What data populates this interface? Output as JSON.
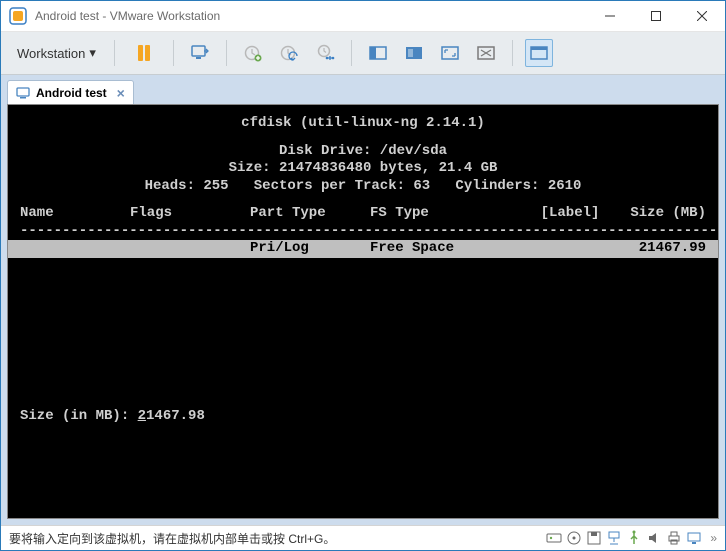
{
  "window": {
    "title": "Android test - VMware Workstation"
  },
  "toolbar": {
    "menu_label": "Workstation"
  },
  "tab": {
    "label": "Android test"
  },
  "terminal": {
    "program": "cfdisk (util-linux-ng 2.14.1)",
    "drive_label": "Disk Drive: /dev/sda",
    "size_line": "Size: 21474836480 bytes, 21.4 GB",
    "geom_line": "Heads: 255   Sectors per Track: 63   Cylinders: 2610",
    "columns": {
      "name": "Name",
      "flags": "Flags",
      "ptype": "Part Type",
      "fstype": "FS Type",
      "label": "[Label]",
      "size": "Size (MB)"
    },
    "row": {
      "name": "",
      "flags": "",
      "ptype": "Pri/Log",
      "fstype": "Free Space",
      "label": "",
      "size": "21467.99"
    },
    "prompt_label": "Size (in MB): ",
    "prompt_first": "2",
    "prompt_rest": "1467.98"
  },
  "status": {
    "message": "要将输入定向到该虚拟机，请在虚拟机内部单击或按 Ctrl+G。"
  }
}
